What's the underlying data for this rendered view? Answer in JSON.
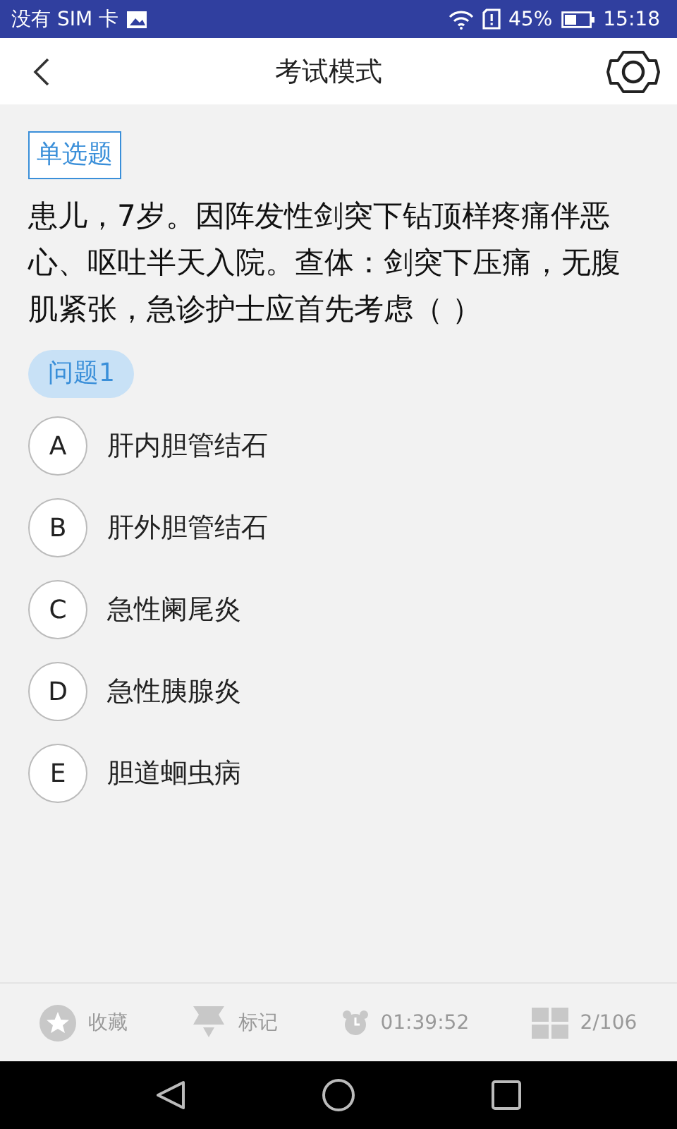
{
  "status_bar": {
    "carrier": "没有 SIM 卡",
    "battery": "45%",
    "time": "15:18"
  },
  "header": {
    "title": "考试模式"
  },
  "question": {
    "type_tag": "单选题",
    "text": "患儿，7岁。因阵发性剑突下钻顶样疼痛伴恶心、呕吐半天入院。查体：剑突下压痛，无腹肌紧张，急诊护士应首先考虑（ ）",
    "number": "问题1"
  },
  "options": [
    {
      "letter": "A",
      "text": "肝内胆管结石",
      "selected": false
    },
    {
      "letter": "B",
      "text": "肝外胆管结石",
      "selected": false
    },
    {
      "letter": "C",
      "text": "急性阑尾炎",
      "selected": false
    },
    {
      "letter": "D",
      "text": "急性胰腺炎",
      "selected": false
    },
    {
      "letter": "E",
      "text": "胆道蛔虫病",
      "selected": false
    }
  ],
  "toolbar": {
    "favorite": "收藏",
    "mark": "标记",
    "timer": "01:39:52",
    "progress": "2/106"
  }
}
